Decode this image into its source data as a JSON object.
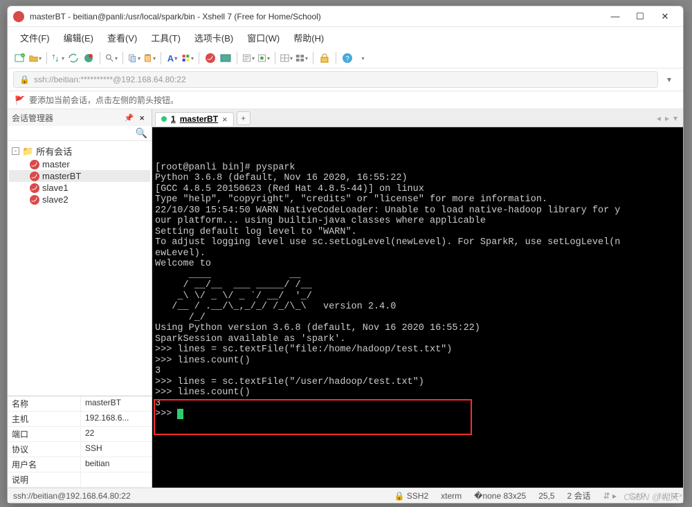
{
  "window": {
    "title": "masterBT - beitian@panli:/usr/local/spark/bin - Xshell 7 (Free for Home/School)"
  },
  "menu": {
    "items": [
      "文件(F)",
      "编辑(E)",
      "查看(V)",
      "工具(T)",
      "选项卡(B)",
      "窗口(W)",
      "帮助(H)"
    ]
  },
  "address": {
    "url": "ssh://beitian:**********@192.168.64.80:22"
  },
  "hint": {
    "text": "要添加当前会话，点击左侧的箭头按钮。"
  },
  "sidebar": {
    "title": "会话管理器",
    "root": "所有会话",
    "sessions": [
      "master",
      "masterBT",
      "slave1",
      "slave2"
    ],
    "selected": "masterBT",
    "props": [
      {
        "k": "名称",
        "v": "masterBT"
      },
      {
        "k": "主机",
        "v": "192.168.6..."
      },
      {
        "k": "端口",
        "v": "22"
      },
      {
        "k": "协议",
        "v": "SSH"
      },
      {
        "k": "用户名",
        "v": "beitian"
      },
      {
        "k": "说明",
        "v": ""
      }
    ]
  },
  "tabs": {
    "active": {
      "index": "1",
      "name": "masterBT"
    }
  },
  "terminal": {
    "lines": [
      "[root@panli bin]# pyspark",
      "Python 3.6.8 (default, Nov 16 2020, 16:55:22)",
      "[GCC 4.8.5 20150623 (Red Hat 4.8.5-44)] on linux",
      "Type \"help\", \"copyright\", \"credits\" or \"license\" for more information.",
      "22/10/30 15:54:50 WARN NativeCodeLoader: Unable to load native-hadoop library for y",
      "our platform... using builtin-java classes where applicable",
      "Setting default log level to \"WARN\".",
      "To adjust logging level use sc.setLogLevel(newLevel). For SparkR, use setLogLevel(n",
      "ewLevel).",
      "Welcome to",
      "      ____              __",
      "     / __/__  ___ _____/ /__",
      "    _\\ \\/ _ \\/ _ `/ __/  '_/",
      "   /__ / .__/\\_,_/_/ /_/\\_\\   version 2.4.0",
      "      /_/",
      "",
      "Using Python version 3.6.8 (default, Nov 16 2020 16:55:22)",
      "SparkSession available as 'spark'.",
      ">>> lines = sc.textFile(\"file:/home/hadoop/test.txt\")",
      ">>> lines.count()",
      "3",
      ">>> lines = sc.textFile(\"/user/hadoop/test.txt\")",
      ">>> lines.count()",
      "3",
      ">>> "
    ]
  },
  "status": {
    "address": "ssh://beitian@192.168.64.80:22",
    "proto": "SSH2",
    "term": "xterm",
    "size": "83x25",
    "pos": "25,5",
    "sessions": "2 会话",
    "cap": "CAP",
    "num": "NUM"
  },
  "watermark": "CSDN @北天*"
}
